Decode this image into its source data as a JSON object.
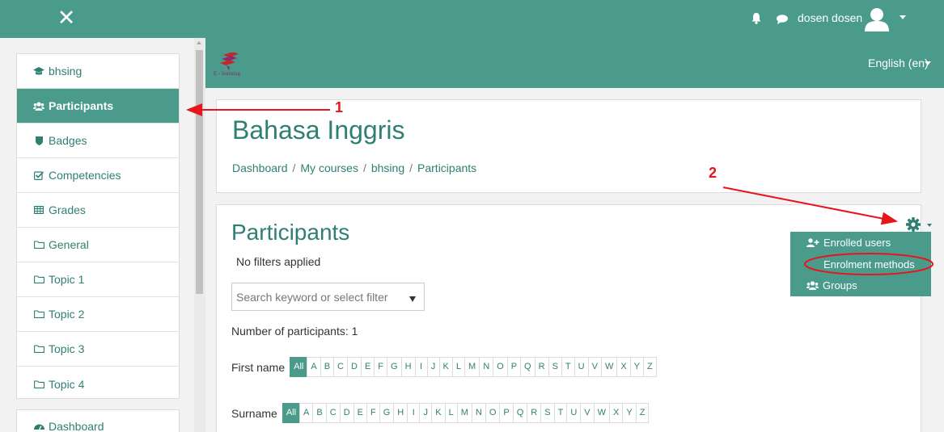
{
  "topbar": {
    "user_name": "dosen dosen"
  },
  "icons": {
    "close": "close-icon",
    "bell": "bell-icon",
    "chat": "chat-icon",
    "avatar": "user-avatar-icon",
    "gear": "gear-icon"
  },
  "sidebar": {
    "items": [
      {
        "label": "bhsing",
        "icon": "graduation-cap-icon"
      },
      {
        "label": "Participants",
        "icon": "users-icon"
      },
      {
        "label": "Badges",
        "icon": "shield-icon"
      },
      {
        "label": "Competencies",
        "icon": "check-square-icon"
      },
      {
        "label": "Grades",
        "icon": "table-icon"
      },
      {
        "label": "General",
        "icon": "folder-icon"
      },
      {
        "label": "Topic 1",
        "icon": "folder-icon"
      },
      {
        "label": "Topic 2",
        "icon": "folder-icon"
      },
      {
        "label": "Topic 3",
        "icon": "folder-icon"
      },
      {
        "label": "Topic 4",
        "icon": "folder-icon"
      }
    ],
    "dashboard": {
      "label": "Dashboard",
      "icon": "dashboard-icon"
    }
  },
  "brand": {
    "logo_text": "E - learning",
    "language": "English (en)"
  },
  "course": {
    "title": "Bahasa Inggris",
    "breadcrumb": [
      "Dashboard",
      "My courses",
      "bhsing",
      "Participants"
    ]
  },
  "participants": {
    "title": "Participants",
    "filters_status": "No filters applied",
    "search_placeholder": "Search keyword or select filter",
    "count_text": "Number of participants: 1",
    "first_name_label": "First name",
    "surname_label": "Surname",
    "all_label": "All",
    "letters": [
      "A",
      "B",
      "C",
      "D",
      "E",
      "F",
      "G",
      "H",
      "I",
      "J",
      "K",
      "L",
      "M",
      "N",
      "O",
      "P",
      "Q",
      "R",
      "S",
      "T",
      "U",
      "V",
      "W",
      "X",
      "Y",
      "Z"
    ]
  },
  "gear_menu": {
    "items": [
      {
        "label": "Enrolled users",
        "icon": "user-plus-icon"
      },
      {
        "label": "Enrolment methods"
      },
      {
        "label": "Groups",
        "icon": "users-icon"
      }
    ]
  },
  "annotations": {
    "arrow1_label": "1",
    "arrow2_label": "2",
    "color": "#e8141b"
  },
  "colors": {
    "theme": "#4a9b8c",
    "link": "#2f7f73"
  }
}
